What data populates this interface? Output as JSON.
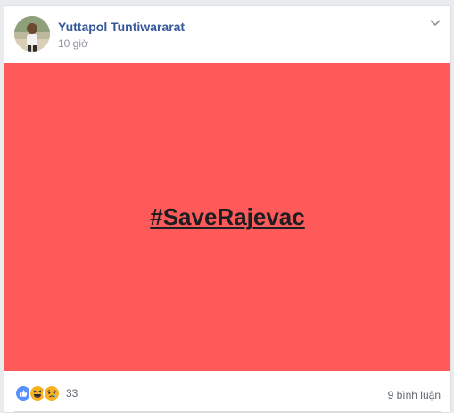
{
  "post": {
    "author_name": "Yuttapol Tuntiwararat",
    "timestamp": "10 giờ",
    "avatar_icon": "profile-photo",
    "menu_icon": "chevron-down-icon",
    "hashtag_text": "#SaveRajevac",
    "background_color": "#ff5a5a"
  },
  "footer": {
    "reaction_icons": [
      "like-icon",
      "haha-icon",
      "sad-icon"
    ],
    "reaction_count": "33",
    "comment_count": "9 bình luận"
  },
  "colors": {
    "author_link": "#365899",
    "like_blue": "#5890ff",
    "emoji_yellow": "#f7b125"
  }
}
